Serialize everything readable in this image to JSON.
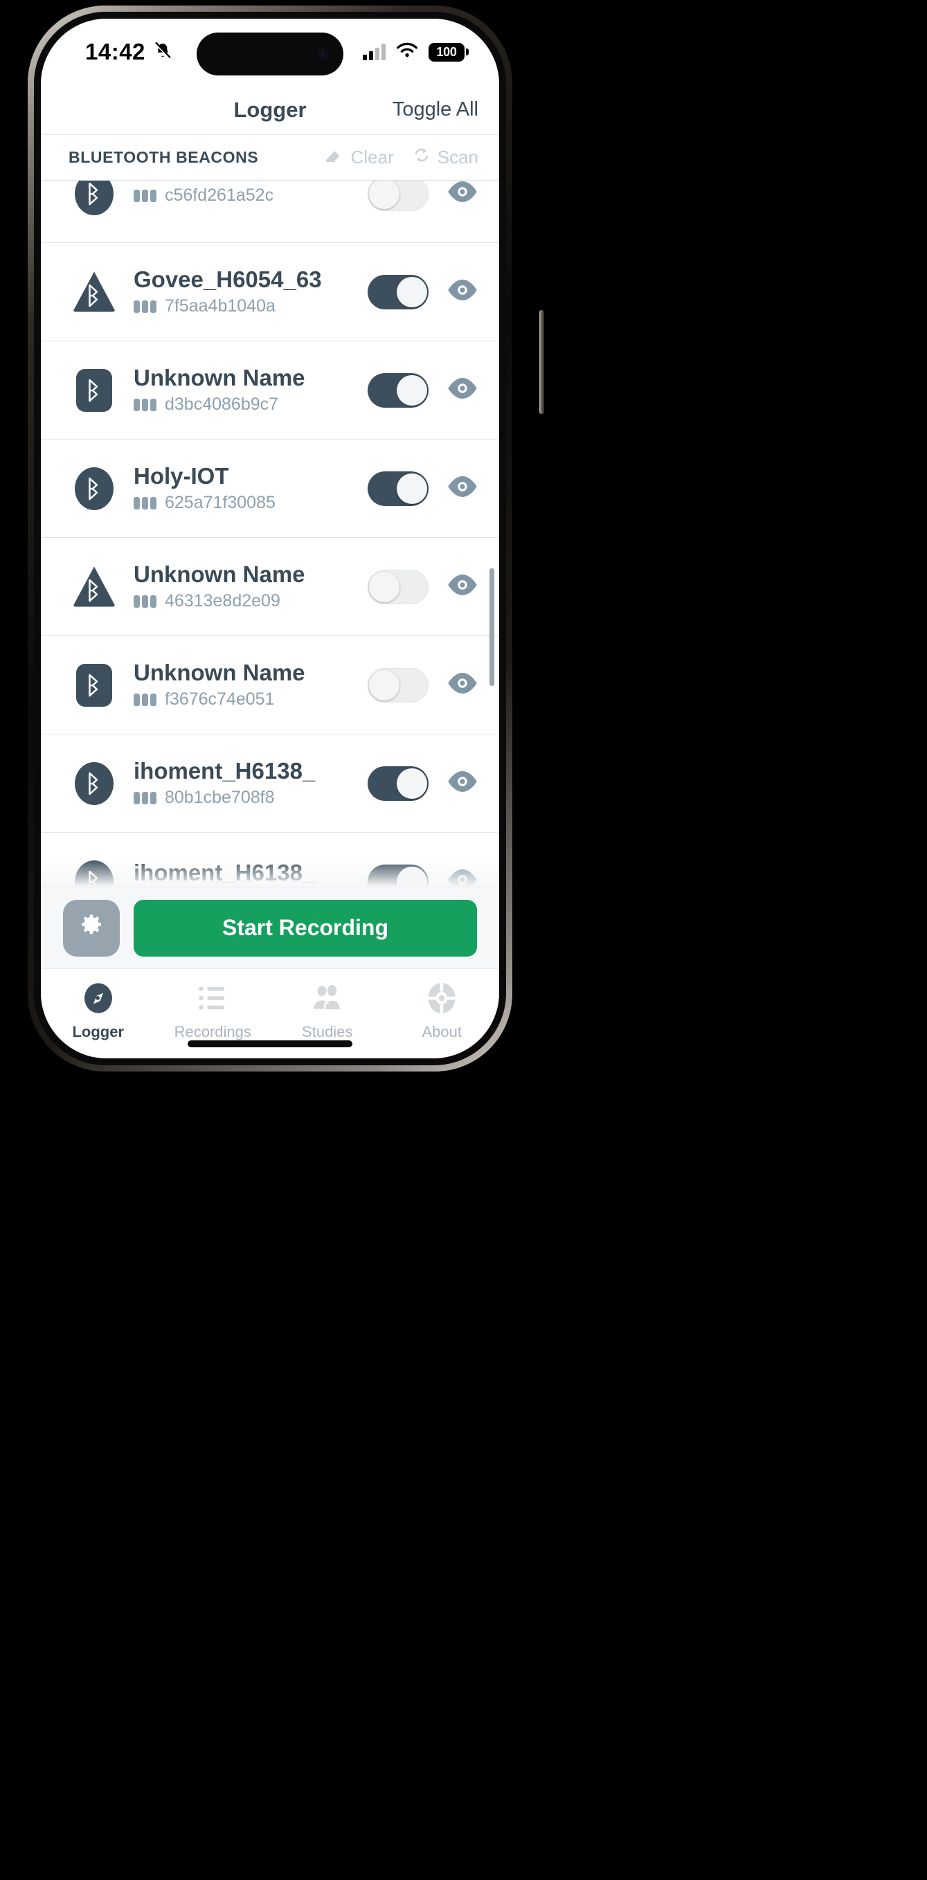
{
  "statusbar": {
    "time": "14:42",
    "bell_icon": "bell-slash-icon",
    "signal_icon": "cellular-bars-icon",
    "wifi_icon": "wifi-icon",
    "battery_level": "100"
  },
  "navbar": {
    "title": "Logger",
    "right_action": "Toggle All"
  },
  "section": {
    "title": "BLUETOOTH BEACONS",
    "clear_label": "Clear",
    "clear_icon": "eraser-icon",
    "scan_label": "Scan",
    "scan_icon": "refresh-icon"
  },
  "beacons": [
    {
      "name": "",
      "id": "c56fd261a52c",
      "shape": "circle",
      "toggle": "off",
      "bars": 3,
      "eye_icon": "eye-icon",
      "partial": "top"
    },
    {
      "name": "Govee_H6054_63",
      "id": "7f5aa4b1040a",
      "shape": "triangle",
      "toggle": "on",
      "bars": 3,
      "eye_icon": "eye-icon"
    },
    {
      "name": "Unknown Name",
      "id": "d3bc4086b9c7",
      "shape": "square",
      "toggle": "on",
      "bars": 3,
      "eye_icon": "eye-icon"
    },
    {
      "name": "Holy-IOT",
      "id": "625a71f30085",
      "shape": "circle",
      "toggle": "on",
      "bars": 3,
      "eye_icon": "eye-icon"
    },
    {
      "name": "Unknown Name",
      "id": "46313e8d2e09",
      "shape": "triangle",
      "toggle": "off",
      "bars": 3,
      "eye_icon": "eye-icon"
    },
    {
      "name": "Unknown Name",
      "id": "f3676c74e051",
      "shape": "square",
      "toggle": "off",
      "bars": 3,
      "eye_icon": "eye-icon"
    },
    {
      "name": "ihoment_H6138_",
      "id": "80b1cbe708f8",
      "shape": "circle",
      "toggle": "on",
      "bars": 3,
      "eye_icon": "eye-icon"
    },
    {
      "name": "ihoment_H6138_",
      "id": "",
      "shape": "circle",
      "toggle": "on",
      "bars": 3,
      "eye_icon": "eye-icon",
      "partial": "bottom"
    }
  ],
  "actionbar": {
    "settings_icon": "gear-icon",
    "record_label": "Start Recording",
    "record_color": "#15a05d"
  },
  "tabbar": {
    "tabs": [
      {
        "label": "Logger",
        "icon": "compass-icon",
        "active": true
      },
      {
        "label": "Recordings",
        "icon": "list-icon",
        "active": false
      },
      {
        "label": "Studies",
        "icon": "people-icon",
        "active": false
      },
      {
        "label": "About",
        "icon": "lifebuoy-icon",
        "active": false
      }
    ]
  },
  "colors": {
    "accent_slate": "#3d4f5d",
    "muted": "#8ea0ae",
    "disabled": "#c2ccd4",
    "green": "#15a05d"
  }
}
